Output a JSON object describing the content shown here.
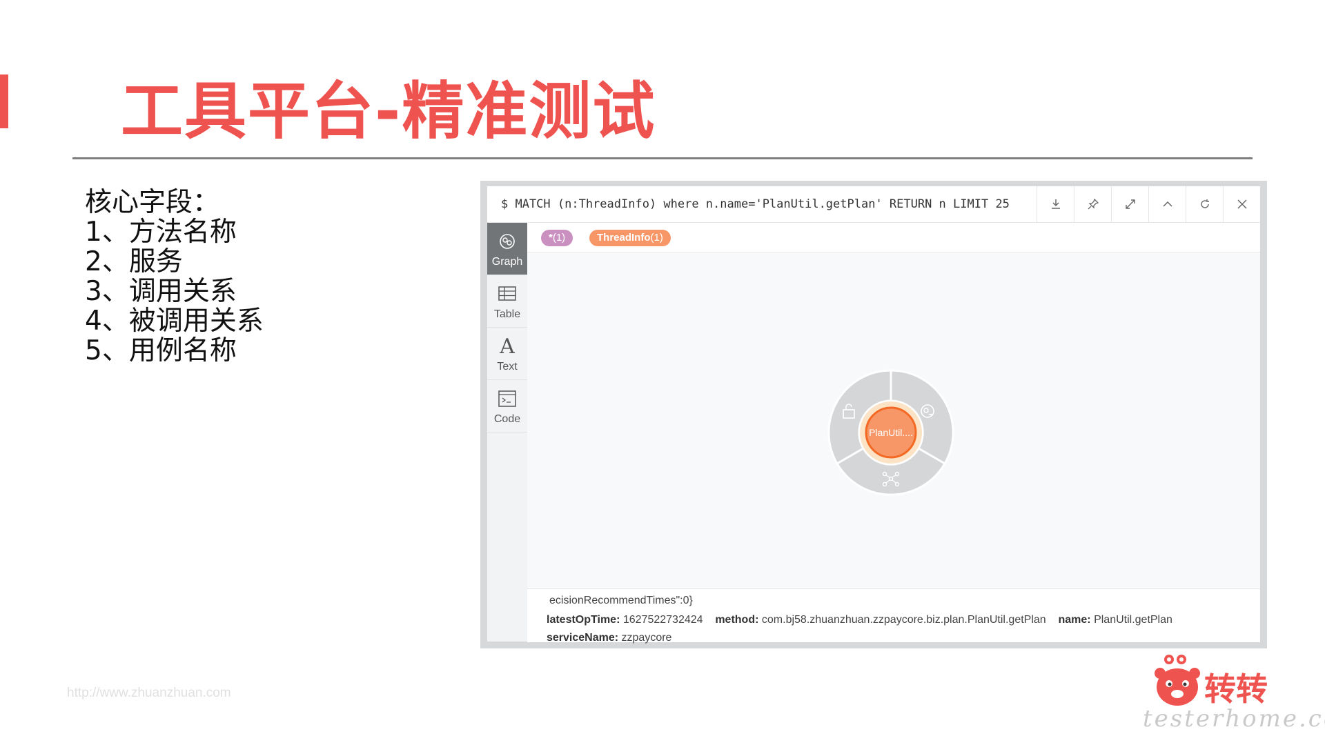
{
  "slide": {
    "title": "工具平台-精准测试",
    "list": [
      "核心字段：",
      "1、方法名称",
      "2、服务",
      "3、调用关系",
      "4、被调用关系",
      "5、用例名称"
    ],
    "footer_url": "http://www.zhuanzhuan.com"
  },
  "neo4j": {
    "query": "$ MATCH (n:ThreadInfo) where n.name='PlanUtil.getPlan' RETURN n LIMIT 25",
    "toolbar": [
      {
        "name": "download-icon",
        "glyph": "⤓"
      },
      {
        "name": "pin-icon",
        "glyph": "⚲"
      },
      {
        "name": "expand-icon",
        "glyph": "⤢"
      },
      {
        "name": "collapse-icon",
        "glyph": "︿"
      },
      {
        "name": "refresh-icon",
        "glyph": "↻"
      },
      {
        "name": "close-icon",
        "glyph": "✕"
      }
    ],
    "sidebar": [
      {
        "label": "Graph",
        "icon": "graph-icon",
        "active": true
      },
      {
        "label": "Table",
        "icon": "table-icon",
        "active": false
      },
      {
        "label": "Text",
        "icon": "text-icon",
        "active": false
      },
      {
        "label": "Code",
        "icon": "code-icon",
        "active": false
      }
    ],
    "labels": {
      "all": {
        "text": "*",
        "count": "(1)",
        "color": "#c990c0"
      },
      "thread": {
        "text": "ThreadInfo",
        "count": "(1)",
        "color": "#f79767"
      }
    },
    "node": {
      "caption": "PlanUtil....",
      "color": "#f79767"
    },
    "props": {
      "line1": "ecisionRecommendTimes\":0}",
      "latestOpTime_key": "latestOpTime:",
      "latestOpTime_val": "1627522732424",
      "method_key": "method:",
      "method_val": "com.bj58.zhuanzhuan.zzpaycore.biz.plan.PlanUtil.getPlan",
      "name_key": "name:",
      "name_val": "PlanUtil.getPlan",
      "serviceName_key": "serviceName:",
      "serviceName_val": "zzpaycore"
    }
  },
  "brand": {
    "logo_text": "转转",
    "watermark": "testerhome.com",
    "color": "#ef5350"
  }
}
